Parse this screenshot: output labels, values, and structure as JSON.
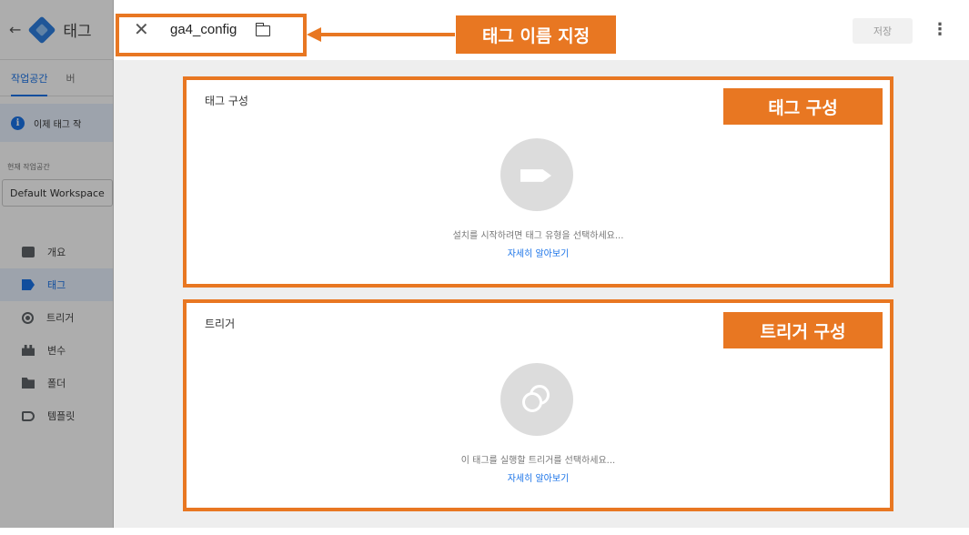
{
  "sidebar": {
    "back_icon": "back-arrow-icon",
    "title": "태그",
    "tabs": [
      "작업공간",
      "버"
    ],
    "notice": "이제 태그 작",
    "workspace_label": "현재 작업공간",
    "workspace_value": "Default Workspace",
    "nav": [
      {
        "label": "개요",
        "icon": "overview-icon"
      },
      {
        "label": "태그",
        "icon": "tag-icon",
        "active": true
      },
      {
        "label": "트리거",
        "icon": "trigger-icon"
      },
      {
        "label": "변수",
        "icon": "variable-icon"
      },
      {
        "label": "폴더",
        "icon": "folder-icon"
      },
      {
        "label": "템플릿",
        "icon": "template-icon"
      }
    ]
  },
  "header": {
    "close_icon": "close-icon",
    "tag_name": "ga4_config",
    "folder_icon": "folder-icon",
    "save_label": "저장",
    "more_icon": "more-vert-icon"
  },
  "cards": {
    "config": {
      "title": "태그 구성",
      "message": "설치를 시작하려면 태그 유형을 선택하세요...",
      "link": "자세히 알아보기"
    },
    "trigger": {
      "title": "트리거",
      "message": "이 태그를 실행할 트리거를 선택하세요...",
      "link": "자세히 알아보기"
    }
  },
  "annotations": {
    "name": "태그 이름 지정",
    "config": "태그 구성",
    "trigger": "트리거 구성",
    "color": "#e87722"
  },
  "colors": {
    "accent": "#1a73e8",
    "annotation": "#e87722"
  }
}
